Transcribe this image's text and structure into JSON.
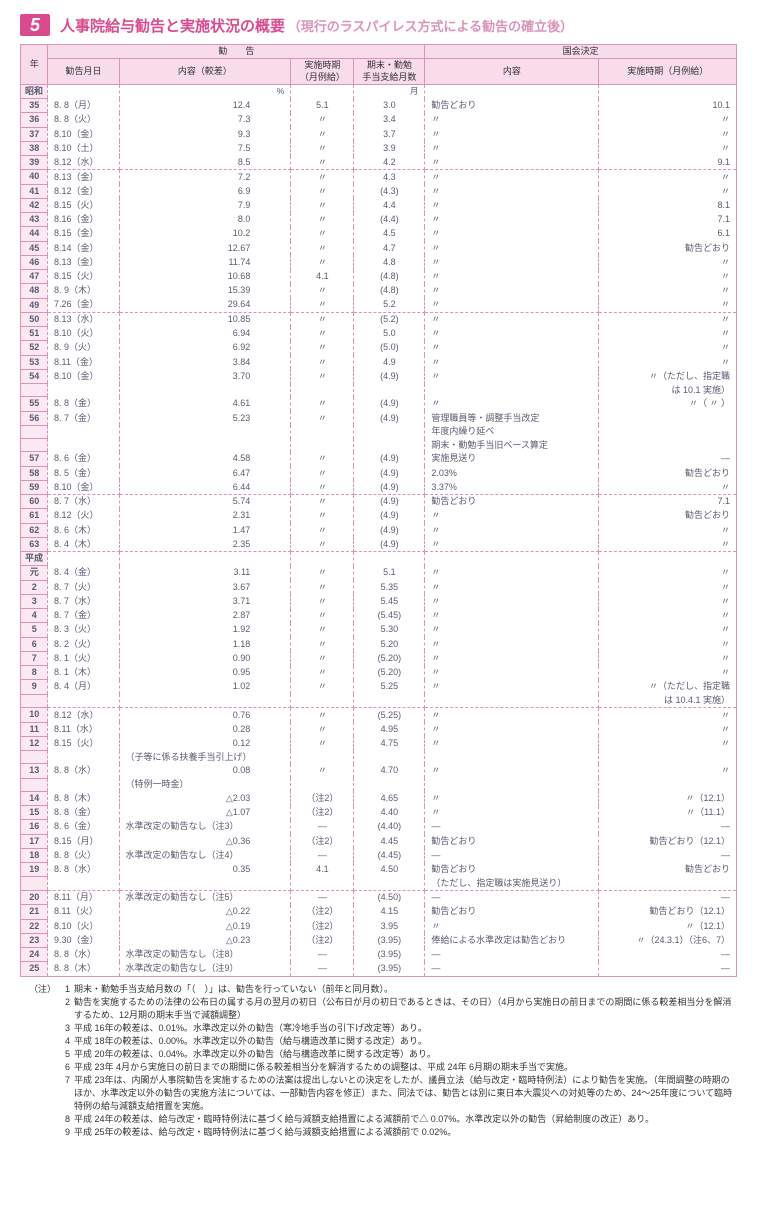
{
  "title": {
    "badge": "5",
    "main": "人事院給与勧告と実施状況の概要",
    "sub": "（現行のラスパイレス方式による勧告の確立後）"
  },
  "header": {
    "year": "年",
    "recommendation": "勧　　告",
    "diet": "国会決定",
    "rec_date": "勧告月日",
    "rec_content": "内容（較差）",
    "rec_timing": "実施時期\n（月例給）",
    "rec_bonus": "期末・勤勉\n手当支給月数",
    "diet_content": "内容",
    "diet_timing": "実施時期（月例給）",
    "unit_pct": "%",
    "unit_month": "月"
  },
  "rows": [
    {
      "era": "昭和",
      "y": "",
      "d": "",
      "c": "",
      "t": "",
      "b": "",
      "dc": "",
      "dt": ""
    },
    {
      "y": "35",
      "d": " 8. 8（月）",
      "c": "12.4",
      "t": "5.1",
      "b": "3.0",
      "dc": "勧告どおり",
      "dt": "10.1"
    },
    {
      "y": "36",
      "d": " 8. 8（火）",
      "c": "7.3",
      "t": "〃",
      "b": "3.4",
      "dc": "〃",
      "dt": "〃"
    },
    {
      "y": "37",
      "d": " 8.10（金）",
      "c": "9.3",
      "t": "〃",
      "b": "3.7",
      "dc": "〃",
      "dt": "〃"
    },
    {
      "y": "38",
      "d": " 8.10（土）",
      "c": "7.5",
      "t": "〃",
      "b": "3.9",
      "dc": "〃",
      "dt": "〃"
    },
    {
      "y": "39",
      "d": " 8.12（水）",
      "c": "8.5",
      "t": "〃",
      "b": "4.2",
      "dc": "〃",
      "dt": "9.1",
      "sep": true
    },
    {
      "y": "40",
      "d": " 8.13（金）",
      "c": "7.2",
      "t": "〃",
      "b": "4.3",
      "dc": "〃",
      "dt": "〃"
    },
    {
      "y": "41",
      "d": " 8.12（金）",
      "c": "6.9",
      "t": "〃",
      "b": "(4.3)",
      "dc": "〃",
      "dt": "〃"
    },
    {
      "y": "42",
      "d": " 8.15（火）",
      "c": "7.9",
      "t": "〃",
      "b": "4.4",
      "dc": "〃",
      "dt": "8.1"
    },
    {
      "y": "43",
      "d": " 8.16（金）",
      "c": "8.0",
      "t": "〃",
      "b": "(4.4)",
      "dc": "〃",
      "dt": "7.1"
    },
    {
      "y": "44",
      "d": " 8.15（金）",
      "c": "10.2",
      "t": "〃",
      "b": "4.5",
      "dc": "〃",
      "dt": "6.1"
    },
    {
      "y": "45",
      "d": " 8.14（金）",
      "c": "12.67",
      "t": "〃",
      "b": "4.7",
      "dc": "〃",
      "dt": "勧告どおり"
    },
    {
      "y": "46",
      "d": " 8.13（金）",
      "c": "11.74",
      "t": "〃",
      "b": "4.8",
      "dc": "〃",
      "dt": "〃"
    },
    {
      "y": "47",
      "d": " 8.15（火）",
      "c": "10.68",
      "t": "4.1",
      "b": "(4.8)",
      "dc": "〃",
      "dt": "〃"
    },
    {
      "y": "48",
      "d": " 8. 9（木）",
      "c": "15.39",
      "t": "〃",
      "b": "(4.8)",
      "dc": "〃",
      "dt": "〃"
    },
    {
      "y": "49",
      "d": " 7.26（金）",
      "c": "29.64",
      "t": "〃",
      "b": "5.2",
      "dc": "〃",
      "dt": "〃",
      "sep": true
    },
    {
      "y": "50",
      "d": " 8.13（水）",
      "c": "10.85",
      "t": "〃",
      "b": "(5.2)",
      "dc": "〃",
      "dt": "〃"
    },
    {
      "y": "51",
      "d": " 8.10（火）",
      "c": "6.94",
      "t": "〃",
      "b": "5.0",
      "dc": "〃",
      "dt": "〃"
    },
    {
      "y": "52",
      "d": " 8. 9（火）",
      "c": "6.92",
      "t": "〃",
      "b": "(5.0)",
      "dc": "〃",
      "dt": "〃"
    },
    {
      "y": "53",
      "d": " 8.11（金）",
      "c": "3.84",
      "t": "〃",
      "b": "4.9",
      "dc": "〃",
      "dt": "〃"
    },
    {
      "y": "54",
      "d": " 8.10（金）",
      "c": "3.70",
      "t": "〃",
      "b": "(4.9)",
      "dc": "〃",
      "dt": "〃（ただし、指定職"
    },
    {
      "y": "",
      "d": "",
      "c": "",
      "t": "",
      "b": "",
      "dc": "",
      "dt": "は 10.1 実施）"
    },
    {
      "y": "55",
      "d": " 8. 8（金）",
      "c": "4.61",
      "t": "〃",
      "b": "(4.9)",
      "dc": "〃",
      "dt": "〃（ 〃 ）"
    },
    {
      "y": "56",
      "d": " 8. 7（金）",
      "c": "5.23",
      "t": "〃",
      "b": "(4.9)",
      "dc": "管理職員等・調整手当改定",
      "dt": ""
    },
    {
      "y": "",
      "d": "",
      "c": "",
      "t": "",
      "b": "",
      "dc": "年度内繰り延べ",
      "dt": ""
    },
    {
      "y": "",
      "d": "",
      "c": "",
      "t": "",
      "b": "",
      "dc": "期末・勤勉手当旧ベース算定",
      "dt": ""
    },
    {
      "y": "57",
      "d": " 8. 6（金）",
      "c": "4.58",
      "t": "〃",
      "b": "(4.9)",
      "dc": "実施見送り",
      "dt": "—"
    },
    {
      "y": "58",
      "d": " 8. 5（金）",
      "c": "6.47",
      "t": "〃",
      "b": "(4.9)",
      "dc": "2.03%",
      "dt": "勧告どおり"
    },
    {
      "y": "59",
      "d": " 8.10（金）",
      "c": "6.44",
      "t": "〃",
      "b": "(4.9)",
      "dc": "3.37%",
      "dt": "〃",
      "sep": true
    },
    {
      "y": "60",
      "d": " 8. 7（水）",
      "c": "5.74",
      "t": "〃",
      "b": "(4.9)",
      "dc": "勧告どおり",
      "dt": "7.1"
    },
    {
      "y": "61",
      "d": " 8.12（火）",
      "c": "2.31",
      "t": "〃",
      "b": "(4.9)",
      "dc": "〃",
      "dt": "勧告どおり"
    },
    {
      "y": "62",
      "d": " 8. 6（木）",
      "c": "1.47",
      "t": "〃",
      "b": "(4.9)",
      "dc": "〃",
      "dt": "〃"
    },
    {
      "y": "63",
      "d": " 8. 4（木）",
      "c": "2.35",
      "t": "〃",
      "b": "(4.9)",
      "dc": "〃",
      "dt": "〃",
      "sep": true
    },
    {
      "era": "平成",
      "y": "",
      "d": "",
      "c": "",
      "t": "",
      "b": "",
      "dc": "",
      "dt": ""
    },
    {
      "y": "元",
      "d": " 8. 4（金）",
      "c": "3.11",
      "t": "〃",
      "b": "5.1",
      "dc": "〃",
      "dt": "〃"
    },
    {
      "y": "2",
      "d": " 8. 7（火）",
      "c": "3.67",
      "t": "〃",
      "b": "5.35",
      "dc": "〃",
      "dt": "〃"
    },
    {
      "y": "3",
      "d": " 8. 7（水）",
      "c": "3.71",
      "t": "〃",
      "b": "5.45",
      "dc": "〃",
      "dt": "〃"
    },
    {
      "y": "4",
      "d": " 8. 7（金）",
      "c": "2.87",
      "t": "〃",
      "b": "(5.45)",
      "dc": "〃",
      "dt": "〃"
    },
    {
      "y": "5",
      "d": " 8. 3（火）",
      "c": "1.92",
      "t": "〃",
      "b": "5.30",
      "dc": "〃",
      "dt": "〃"
    },
    {
      "y": "6",
      "d": " 8. 2（火）",
      "c": "1.18",
      "t": "〃",
      "b": "5.20",
      "dc": "〃",
      "dt": "〃"
    },
    {
      "y": "7",
      "d": " 8. 1（火）",
      "c": "0.90",
      "t": "〃",
      "b": "(5.20)",
      "dc": "〃",
      "dt": "〃"
    },
    {
      "y": "8",
      "d": " 8. 1（木）",
      "c": "0.95",
      "t": "〃",
      "b": "(5.20)",
      "dc": "〃",
      "dt": "〃"
    },
    {
      "y": "9",
      "d": " 8. 4（月）",
      "c": "1.02",
      "t": "〃",
      "b": "5.25",
      "dc": "〃",
      "dt": "〃（ただし、指定職"
    },
    {
      "y": "",
      "d": "",
      "c": "",
      "t": "",
      "b": "",
      "dc": "",
      "dt": "は 10.4.1 実施）",
      "sep": true
    },
    {
      "y": "10",
      "d": " 8.12（水）",
      "c": "0.76",
      "t": "〃",
      "b": "(5.25)",
      "dc": "〃",
      "dt": "〃"
    },
    {
      "y": "11",
      "d": " 8.11（水）",
      "c": "0.28",
      "t": "〃",
      "b": "4.95",
      "dc": "〃",
      "dt": "〃"
    },
    {
      "y": "12",
      "d": " 8.15（火）",
      "c": "0.12",
      "t": "〃",
      "b": "4.75",
      "dc": "〃",
      "dt": "〃"
    },
    {
      "y": "",
      "d": "",
      "c": "（子等に係る扶養手当引上げ）",
      "cleft": true,
      "t": "",
      "b": "",
      "dc": "",
      "dt": ""
    },
    {
      "y": "13",
      "d": " 8. 8（水）",
      "c": "0.08",
      "t": "〃",
      "b": "4.70",
      "dc": "〃",
      "dt": "〃"
    },
    {
      "y": "",
      "d": "",
      "c": "（特例一時金）",
      "cleft": true,
      "t": "",
      "b": "",
      "dc": "",
      "dt": ""
    },
    {
      "y": "14",
      "d": " 8. 8（木）",
      "c": "△2.03",
      "t": "（注2）",
      "b": "4.65",
      "dc": "〃",
      "dt": "〃（12.1）"
    },
    {
      "y": "15",
      "d": " 8. 8（金）",
      "c": "△1.07",
      "t": "（注2）",
      "b": "4.40",
      "dc": "〃",
      "dt": "〃（11.1）"
    },
    {
      "y": "16",
      "d": " 8. 6（金）",
      "c": "水準改定の勧告なし（注3）",
      "cleft": true,
      "t": "—",
      "b": "(4.40)",
      "dc": "—",
      "dt": "—"
    },
    {
      "y": "17",
      "d": " 8.15（月）",
      "c": "△0.36",
      "t": "（注2）",
      "b": "4.45",
      "dc": "勧告どおり",
      "dt": "勧告どおり（12.1）"
    },
    {
      "y": "18",
      "d": " 8. 8（火）",
      "c": "水準改定の勧告なし（注4）",
      "cleft": true,
      "t": "—",
      "b": "(4.45)",
      "dc": "—",
      "dt": "—"
    },
    {
      "y": "19",
      "d": " 8. 8（水）",
      "c": "0.35",
      "t": "4.1",
      "b": "4.50",
      "dc": "勧告どおり",
      "dt": "勧告どおり"
    },
    {
      "y": "",
      "d": "",
      "c": "",
      "t": "",
      "b": "",
      "dc": "（ただし、指定職は実施見送り）",
      "dt": "",
      "sep": true
    },
    {
      "y": "20",
      "d": " 8.11（月）",
      "c": "水準改定の勧告なし（注5）",
      "cleft": true,
      "t": "—",
      "b": "(4.50)",
      "dc": "—",
      "dt": "—"
    },
    {
      "y": "21",
      "d": " 8.11（火）",
      "c": "△0.22",
      "t": "（注2）",
      "b": "4.15",
      "dc": "勧告どおり",
      "dt": "勧告どおり（12.1）"
    },
    {
      "y": "22",
      "d": " 8.10（火）",
      "c": "△0.19",
      "t": "（注2）",
      "b": "3.95",
      "dc": "〃",
      "dt": "〃（12.1）"
    },
    {
      "y": "23",
      "d": " 9.30（金）",
      "c": "△0.23",
      "t": "（注2）",
      "b": "(3.95)",
      "dc": "俸給による水準改定は勧告どおり",
      "dt": "〃（24.3.1）（注6、7）"
    },
    {
      "y": "24",
      "d": " 8. 8（水）",
      "c": "水準改定の勧告なし（注8）",
      "cleft": true,
      "t": "—",
      "b": "(3.95)",
      "dc": "—",
      "dt": "—"
    },
    {
      "y": "25",
      "d": " 8. 8（木）",
      "c": "水準改定の勧告なし（注9）",
      "cleft": true,
      "t": "—",
      "b": "(3.95)",
      "dc": "—",
      "dt": "—",
      "last": true
    }
  ],
  "notes": {
    "label": "（注）",
    "items": [
      {
        "n": "1",
        "t": "期末・勤勉手当支給月数の「（　）」は、勧告を行っていない（前年と同月数）。"
      },
      {
        "n": "2",
        "t": "勧告を実施するための法律の公布日の属する月の翌月の初日（公布日が月の初日であるときは、その日）（4月から実施日の前日までの期間に係る較差相当分を解消するため、12月期の期末手当で減額調整）"
      },
      {
        "n": "3",
        "t": "平成 16年の較差は、0.01%。水準改定以外の勧告（寒冷地手当の引下げ改定等）あり。"
      },
      {
        "n": "4",
        "t": "平成 18年の較差は、0.00%。水準改定以外の勧告（給与構造改革に関する改定）あり。"
      },
      {
        "n": "5",
        "t": "平成 20年の較差は、0.04%。水準改定以外の勧告（給与構造改革に関する改定等）あり。"
      },
      {
        "n": "6",
        "t": "平成 23年 4月から実施日の前日までの期間に係る較差相当分を解消するための調整は、平成 24年 6月期の期末手当で実施。"
      },
      {
        "n": "7",
        "t": "平成 23年は、内閣が人事院勧告を実施するための法案は提出しないとの決定をしたが、議員立法（給与改定・臨時特例法）により勧告を実施。（年間調整の時期のほか、水準改定以外の勧告の実施方法については、一部勧告内容を修正）また、同法では、勧告とは別に東日本大震災への対処等のため、24～25年度について臨時特例の給与減額支給措置を実施。"
      },
      {
        "n": "8",
        "t": "平成 24年の較差は、給与改定・臨時特例法に基づく給与減額支給措置による減額前で△ 0.07%。水準改定以外の勧告（昇給制度の改正）あり。"
      },
      {
        "n": "9",
        "t": "平成 25年の較差は、給与改定・臨時特例法に基づく給与減額支給措置による減額前で 0.02%。"
      }
    ]
  }
}
